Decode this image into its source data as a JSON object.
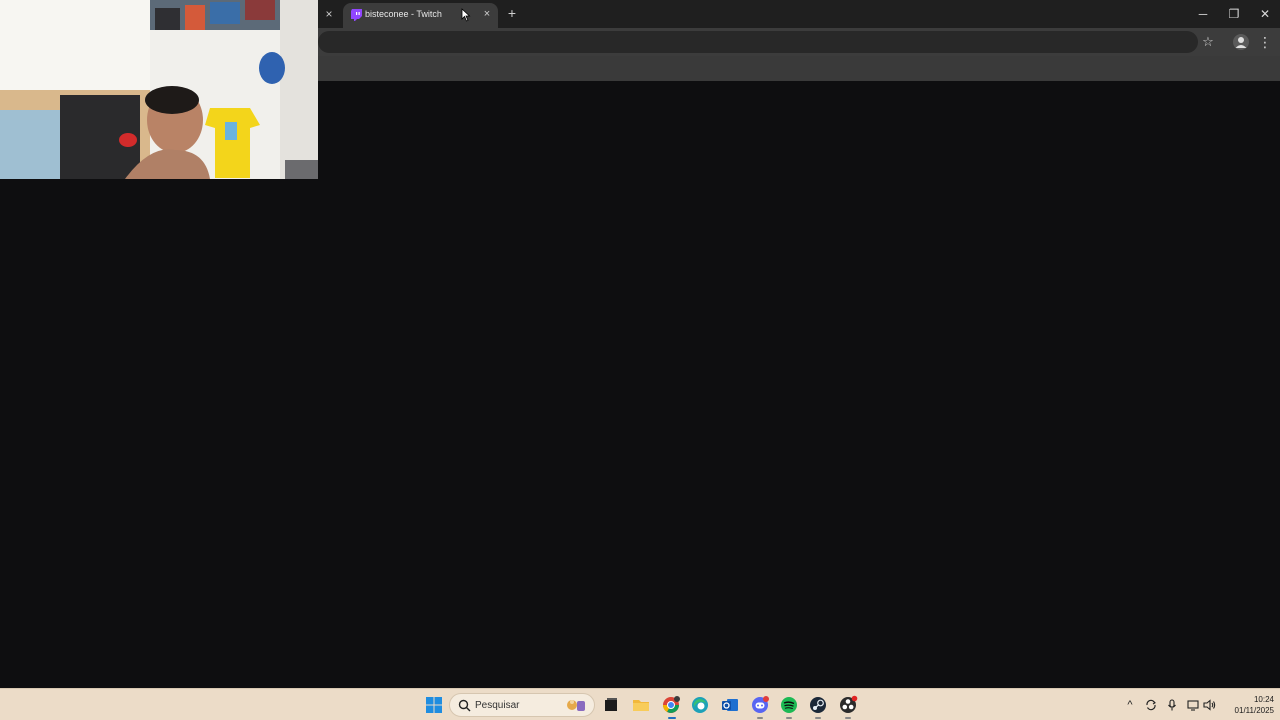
{
  "browser": {
    "tab": {
      "title": "bisteconee - Twitch"
    },
    "prev_tab_close": "×",
    "tab_close": "×",
    "new_tab": "+",
    "window": {
      "minimize": "─",
      "restore": "❐",
      "close": "✕"
    },
    "toolbar": {
      "star": "☆",
      "menu": "⋮"
    }
  },
  "taskbar": {
    "search": {
      "placeholder": "Pesquisar"
    },
    "clock": {
      "time": "10:24",
      "date": "01/11/2025"
    },
    "tray": {
      "chevron": "^",
      "mic": "🎙",
      "volume": "🔊"
    }
  },
  "colors": {
    "twitch": "#9146ff",
    "chrome_dark": "#1f1f1f",
    "content_bg": "#0e0e10",
    "taskbar_bg": "#ecdcc8"
  }
}
